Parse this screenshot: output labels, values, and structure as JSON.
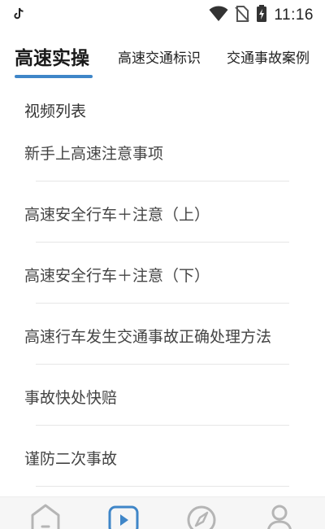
{
  "status_bar": {
    "time": "11:16",
    "icons": [
      "tiktok-icon",
      "wifi-icon",
      "no-sim-icon",
      "battery-charging-icon"
    ]
  },
  "tabs": [
    {
      "label": "高速实操",
      "active": true
    },
    {
      "label": "高速交通标识",
      "active": false
    },
    {
      "label": "交通事故案例",
      "active": false
    }
  ],
  "section": {
    "title": "视频列表"
  },
  "videos": [
    {
      "title": "新手上高速注意事项"
    },
    {
      "title": "高速安全行车＋注意（上）"
    },
    {
      "title": "高速安全行车＋注意（下）"
    },
    {
      "title": "高速行车发生交通事故正确处理方法"
    },
    {
      "title": "事故快处快赔"
    },
    {
      "title": "谨防二次事故"
    }
  ],
  "bottom_nav": [
    {
      "icon": "home-icon",
      "active": false
    },
    {
      "icon": "video-icon",
      "active": true
    },
    {
      "icon": "compass-icon",
      "active": false
    },
    {
      "icon": "profile-icon",
      "active": false
    }
  ],
  "colors": {
    "accent": "#3f86c8",
    "nav_inactive": "#b5b5b5",
    "divider": "#e6e6e6"
  }
}
